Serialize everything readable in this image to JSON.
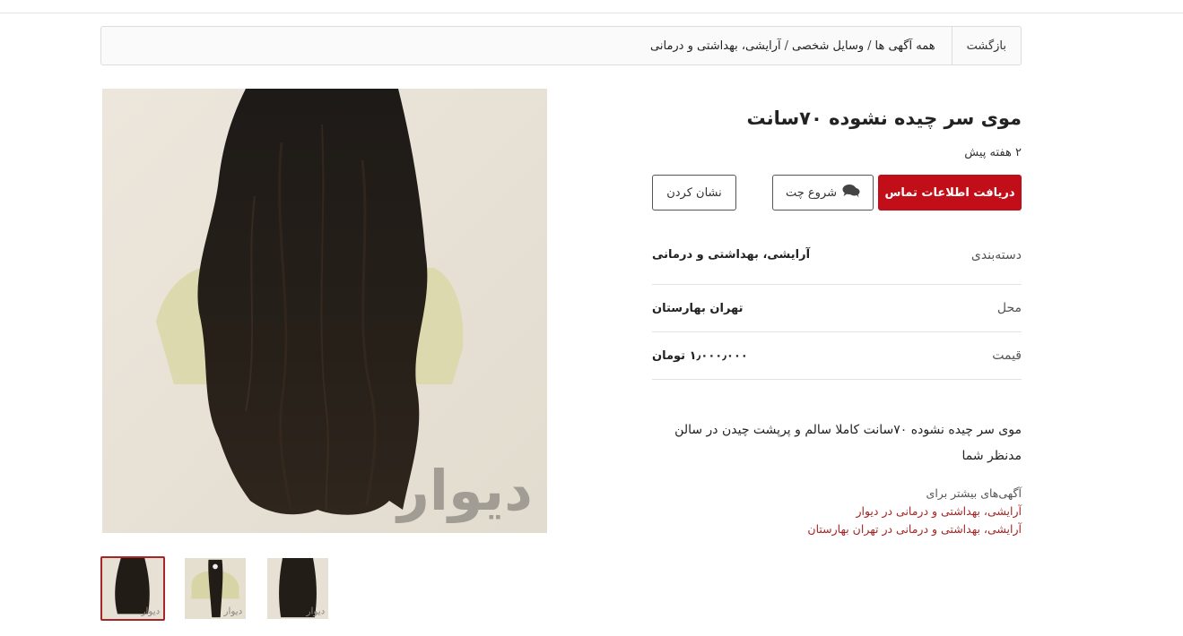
{
  "breadcrumb": {
    "back_label": "بازگشت",
    "items": [
      "همه آگهی ها",
      "وسایل شخصی",
      "آرایشی، بهداشتی و درمانی"
    ],
    "separator": "/"
  },
  "ad": {
    "title": "موی سر چیده نشوده ۷۰سانت",
    "posted": "۲ هفته پیش",
    "watermark": "دیوار",
    "actions": {
      "contact_label": "دریافت اطلاعات تماس",
      "chat_label": "شروع چت",
      "bookmark_label": "نشان کردن"
    },
    "details": [
      {
        "key": "دسته‌بندی",
        "value": "آرایشی، بهداشتی و درمانی"
      },
      {
        "key": "محل",
        "value": "تهران بهارستان"
      },
      {
        "key": "قیمت",
        "value": "۱٫۰۰۰٫۰۰۰ تومان"
      }
    ],
    "description": "موی سر چیده نشوده ۷۰سانت کاملا سالم و پرپشت چیدن در سالن مدنظر شما",
    "more": {
      "label": "آگهی‌های بیشتر برای",
      "links": [
        "آرایشی، بهداشتی و درمانی در دیوار",
        "آرایشی، بهداشتی و درمانی در تهران بهارستان"
      ]
    }
  },
  "colors": {
    "accent": "#c20e19",
    "link": "#a62626"
  },
  "icons": {
    "chat": "comments-icon"
  }
}
